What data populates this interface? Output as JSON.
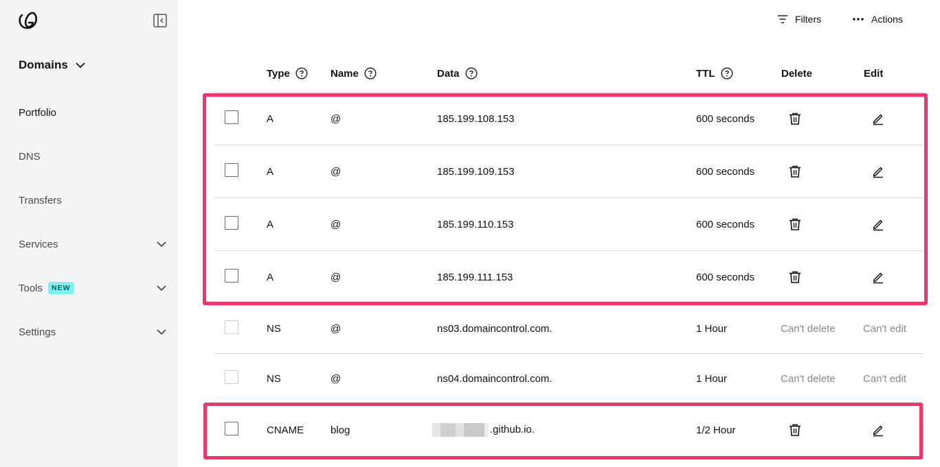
{
  "sidebar": {
    "domains_label": "Domains",
    "items": [
      {
        "label": "Portfolio"
      },
      {
        "label": "DNS"
      },
      {
        "label": "Transfers"
      },
      {
        "label": "Services"
      },
      {
        "label": "Tools",
        "badge": "NEW"
      },
      {
        "label": "Settings"
      }
    ]
  },
  "toolbar": {
    "filters_label": "Filters",
    "actions_label": "Actions"
  },
  "table": {
    "headers": {
      "type": "Type",
      "name": "Name",
      "data": "Data",
      "ttl": "TTL",
      "delete": "Delete",
      "edit": "Edit"
    },
    "rows": [
      {
        "type": "A",
        "name": "@",
        "data": "185.199.108.153",
        "ttl": "600 seconds"
      },
      {
        "type": "A",
        "name": "@",
        "data": "185.199.109.153",
        "ttl": "600 seconds"
      },
      {
        "type": "A",
        "name": "@",
        "data": "185.199.110.153",
        "ttl": "600 seconds"
      },
      {
        "type": "A",
        "name": "@",
        "data": "185.199.111.153",
        "ttl": "600 seconds"
      },
      {
        "type": "NS",
        "name": "@",
        "data": "ns03.domaincontrol.com.",
        "ttl": "1 Hour",
        "delete_text": "Can't delete",
        "edit_text": "Can't edit"
      },
      {
        "type": "NS",
        "name": "@",
        "data": "ns04.domaincontrol.com.",
        "ttl": "1 Hour",
        "delete_text": "Can't delete",
        "edit_text": "Can't edit"
      },
      {
        "type": "CNAME",
        "name": "blog",
        "data": ".github.io.",
        "ttl": "1/2 Hour"
      }
    ]
  },
  "colors": {
    "sidebar_bg": "#f3f4f5",
    "highlight": "#f0356b",
    "badge_bg": "#7ff3ee"
  }
}
